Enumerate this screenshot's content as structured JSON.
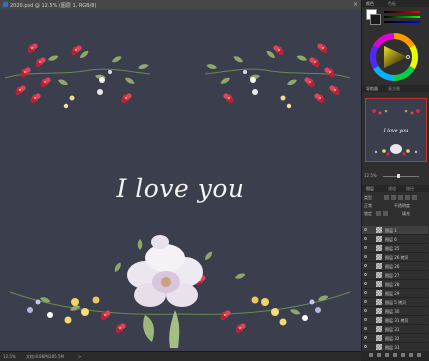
{
  "window": {
    "tab_title": "2020.psd @ 12.5% (图层 1, RGB/8)",
    "close_glyph": "×"
  },
  "canvas": {
    "text": "I love you",
    "background": "#3a3e4d"
  },
  "status_bar": {
    "zoom": "12.5%",
    "doc_info": "文档:8.86M/285.5M",
    "arrow": ">"
  },
  "color_panel": {
    "tab_color": "颜色",
    "tab_swatches": "色板",
    "foreground": "#ffffff",
    "background": "#1a1a1a"
  },
  "navigator_panel": {
    "tab_navigator": "导航器",
    "tab_histogram": "直方图",
    "thumbnail_text": "I love you",
    "zoom_value": "12.5%"
  },
  "layers_panel": {
    "tab_layers": "图层",
    "tab_channels": "通道",
    "tab_paths": "路径",
    "kind_filter": "类型",
    "blend_mode": "正常",
    "opacity_label": "不透明度",
    "lock_label": "锁定",
    "fill_label": "填充",
    "layers": [
      {
        "name": "图层 1",
        "selected": true
      },
      {
        "name": "图层 6",
        "selected": false
      },
      {
        "name": "图层 25",
        "selected": false
      },
      {
        "name": "图层 26 拷贝",
        "selected": false
      },
      {
        "name": "图层 26",
        "selected": false
      },
      {
        "name": "图层 27",
        "selected": false
      },
      {
        "name": "图层 28",
        "selected": false
      },
      {
        "name": "图层 29",
        "selected": false
      },
      {
        "name": "图层 5 拷贝",
        "selected": false
      },
      {
        "name": "图层 30",
        "selected": false
      },
      {
        "name": "图层 31 拷贝",
        "selected": false
      },
      {
        "name": "图层 31",
        "selected": false
      },
      {
        "name": "图层 32",
        "selected": false
      },
      {
        "name": "图层 33",
        "selected": false
      },
      {
        "name": "图层 34",
        "selected": false
      }
    ]
  }
}
